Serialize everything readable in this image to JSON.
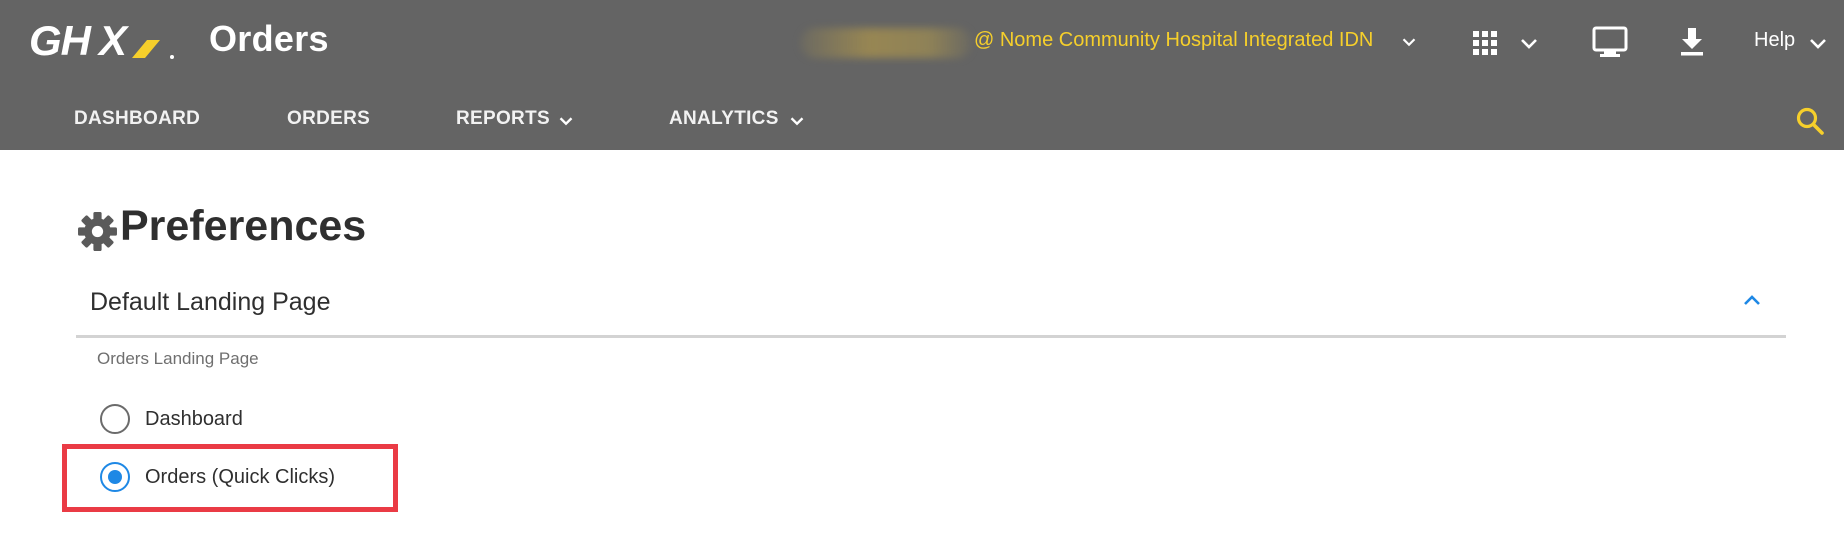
{
  "header": {
    "logo_text": "GHX",
    "app_title": "Orders",
    "organization": "@ Nome Community Hospital Integrated IDN",
    "help_label": "Help",
    "icons": [
      "apps-grid-icon",
      "chevron-down-icon",
      "monitor-icon",
      "download-icon",
      "search-icon"
    ],
    "colors": {
      "bar": "#646464",
      "org_text": "#f6cf2b",
      "accent": "#f6cf2b"
    }
  },
  "nav": {
    "items": [
      {
        "label": "DASHBOARD",
        "has_dropdown": false
      },
      {
        "label": "ORDERS",
        "has_dropdown": false
      },
      {
        "label": "REPORTS",
        "has_dropdown": true
      },
      {
        "label": "ANALYTICS",
        "has_dropdown": true
      }
    ]
  },
  "page": {
    "title": "Preferences",
    "icon": "gear-icon"
  },
  "section": {
    "title": "Default Landing Page",
    "expanded": true,
    "field_label": "Orders Landing Page",
    "options": [
      {
        "label": "Dashboard",
        "checked": false
      },
      {
        "label": "Orders (Quick Clicks)",
        "checked": true
      }
    ],
    "colors": {
      "radio_selected": "#1e88e5",
      "highlight": "#ea3b45"
    }
  }
}
